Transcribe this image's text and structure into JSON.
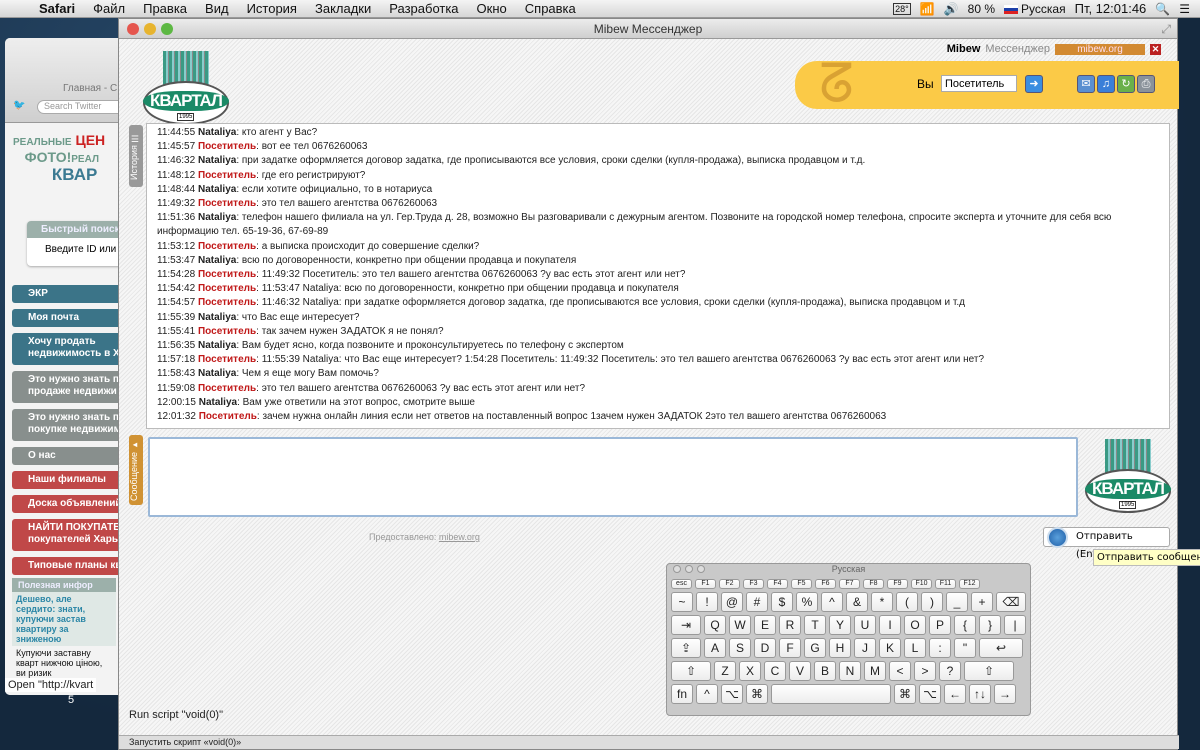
{
  "menubar": {
    "app": "Safari",
    "items": [
      "Файл",
      "Правка",
      "Вид",
      "История",
      "Закладки",
      "Разработка",
      "Окно",
      "Справка"
    ],
    "status": {
      "temp": "28°",
      "battery": "80 %",
      "input_source": "Русская",
      "clock": "Пт, 12:01:46"
    }
  },
  "safari": {
    "bookmark": "Главная - С",
    "search_placeholder": "Search Twitter",
    "promo": [
      "РЕАЛЬНЫЕ",
      "ЦЕН",
      "ФОТО!",
      "РЕАЛ",
      "КВАР"
    ],
    "quick_search": {
      "title": "Быстрый поиск",
      "hint": "Введите ID или"
    },
    "nav": [
      {
        "label": "ЭКР",
        "c": "t"
      },
      {
        "label": "Моя почта",
        "c": "t"
      },
      {
        "label": "Хочу продать недвижимость в Х",
        "c": "t"
      },
      {
        "label": "Это нужно знать п продаже недвижи",
        "c": "g"
      },
      {
        "label": "Это нужно знать п покупке недвижим",
        "c": "g"
      },
      {
        "label": "О нас",
        "c": "g"
      },
      {
        "label": "Наши филиалы",
        "c": "r"
      },
      {
        "label": "Доска объявлений",
        "c": "r"
      },
      {
        "label": "НАЙТИ ПОКУПАТЕ покупателей Хары",
        "c": "r"
      },
      {
        "label": "Типовые планы кв",
        "c": "r"
      }
    ],
    "info": {
      "title": "Полезная инфор",
      "article_title": "Дешево, але сердито: знати, купуючи застав квартиру за зниженою",
      "article_text": "Купуючи заставну кварт нижчою ціною, ви ризик"
    },
    "status": "Open \"http://kvart",
    "page_number": "5"
  },
  "window": {
    "title": "Mibew Мессенджер"
  },
  "header": {
    "brand": "Mibew",
    "brand_suffix": "Мессенджер",
    "link": "mibew.org",
    "logo_text": "КВАРТАЛ",
    "logo_year": "1995",
    "you_label": "Вы",
    "name_value": "Посетитель"
  },
  "tabs": {
    "history": "История",
    "message": "Сообщение"
  },
  "chat": [
    {
      "t": "11:44:55",
      "a": "Nataliya",
      "v": false,
      "m": "кто агент у Вас?"
    },
    {
      "t": "11:45:57",
      "a": "Посетитель",
      "v": true,
      "m": "вот ее тел 0676260063"
    },
    {
      "t": "11:46:32",
      "a": "Nataliya",
      "v": false,
      "m": "при задатке оформляется договор задатка, где прописываются все условия, сроки сделки (купля-продажа), выписка продавцом и т.д."
    },
    {
      "t": "11:48:12",
      "a": "Посетитель",
      "v": true,
      "m": "где его регистрируют?"
    },
    {
      "t": "11:48:44",
      "a": "Nataliya",
      "v": false,
      "m": "если хотите официально, то в нотариуса"
    },
    {
      "t": "11:49:32",
      "a": "Посетитель",
      "v": true,
      "m": "это тел вашего агентства 0676260063"
    },
    {
      "t": "11:51:36",
      "a": "Nataliya",
      "v": false,
      "m": "телефон нашего филиала на ул. Гер.Труда д. 28, возможно Вы разговаривали с дежурным агентом. Позвоните на городской номер телефона, спросите эксперта и уточните для себя всю информацию тел. 65-19-36, 67-69-89"
    },
    {
      "t": "11:53:12",
      "a": "Посетитель",
      "v": true,
      "m": "а выписка происходит до совершение сделки?"
    },
    {
      "t": "11:53:47",
      "a": "Nataliya",
      "v": false,
      "m": "всю по договоренности, конкретно при общении продавца и покупателя"
    },
    {
      "t": "11:54:28",
      "a": "Посетитель",
      "v": true,
      "m": "11:49:32 Посетитель: это тел вашего агентства 0676260063 ?у вас есть этот агент или нет?"
    },
    {
      "t": "11:54:42",
      "a": "Посетитель",
      "v": true,
      "m": "11:53:47 Nataliya: всю по договоренности, конкретно при общении продавца и покупателя"
    },
    {
      "t": "11:54:57",
      "a": "Посетитель",
      "v": true,
      "m": "11:46:32 Nataliya: при задатке оформляется договор задатка, где прописываются все условия, сроки сделки (купля-продажа), выписка продавцом и т.д"
    },
    {
      "t": "11:55:39",
      "a": "Nataliya",
      "v": false,
      "m": "что Вас еще интересует?"
    },
    {
      "t": "11:55:41",
      "a": "Посетитель",
      "v": true,
      "m": "так зачем нужен ЗАДАТОК я не понял?"
    },
    {
      "t": "11:56:35",
      "a": "Nataliya",
      "v": false,
      "m": "Вам будет ясно, когда позвоните и проконсультируетесь по телефону с экспертом"
    },
    {
      "t": "11:57:18",
      "a": "Посетитель",
      "v": true,
      "m": "11:55:39 Nataliya: что Вас еще интересует? 1:54:28 Посетитель: 11:49:32 Посетитель: это тел вашего агентства 0676260063 ?у вас есть этот агент или нет?"
    },
    {
      "t": "11:58:43",
      "a": "Nataliya",
      "v": false,
      "m": "Чем я еще могу Вам помочь?"
    },
    {
      "t": "11:59:08",
      "a": "Посетитель",
      "v": true,
      "m": "это тел вашего агентства 0676260063 ?у вас есть этот агент или нет?"
    },
    {
      "t": "12:00:15",
      "a": "Nataliya",
      "v": false,
      "m": "Вам уже ответили на этот вопрос, смотрите выше"
    },
    {
      "t": "12:01:32",
      "a": "Посетитель",
      "v": true,
      "m": "зачем нужна онлайн линия если нет ответов на поставленный вопрос 1зачем нужен ЗАДАТОК 2это тел вашего агентства 0676260063"
    }
  ],
  "footer": {
    "provided_by": "Предоставлено:",
    "provided_link": "mibew.org",
    "send": "Отправить (Enter)",
    "send_tooltip": "Отправить сообщение",
    "run_script": "Run script \"void(0)\"",
    "status": "Запустить скрипт «void(0)»"
  },
  "keyboard": {
    "title": "Русская",
    "rows": [
      [
        "esc",
        "F1",
        "F2",
        "F3",
        "F4",
        "F5",
        "F6",
        "F7",
        "F8",
        "F9",
        "F10",
        "F11",
        "F12"
      ],
      [
        "~",
        "!",
        "@",
        "#",
        "$",
        "%",
        "^",
        "&",
        "*",
        "(",
        ")",
        "_",
        "+",
        "⌫"
      ],
      [
        "⇥",
        "Q",
        "W",
        "E",
        "R",
        "T",
        "Y",
        "U",
        "I",
        "O",
        "P",
        "{",
        "}",
        "|"
      ],
      [
        "⇪",
        "A",
        "S",
        "D",
        "F",
        "G",
        "H",
        "J",
        "K",
        "L",
        ":",
        "\"",
        "↩"
      ],
      [
        "⇧",
        "Z",
        "X",
        "C",
        "V",
        "B",
        "N",
        "M",
        "<",
        ">",
        "?",
        "⇧"
      ],
      [
        "fn",
        "^",
        "⌥",
        "⌘",
        " ",
        "⌘",
        "⌥",
        "←",
        "↑↓",
        "→"
      ]
    ]
  },
  "colors": {
    "visitor": "#c01818",
    "banner": "#fbca47",
    "logo_green": "#1b8a67"
  }
}
